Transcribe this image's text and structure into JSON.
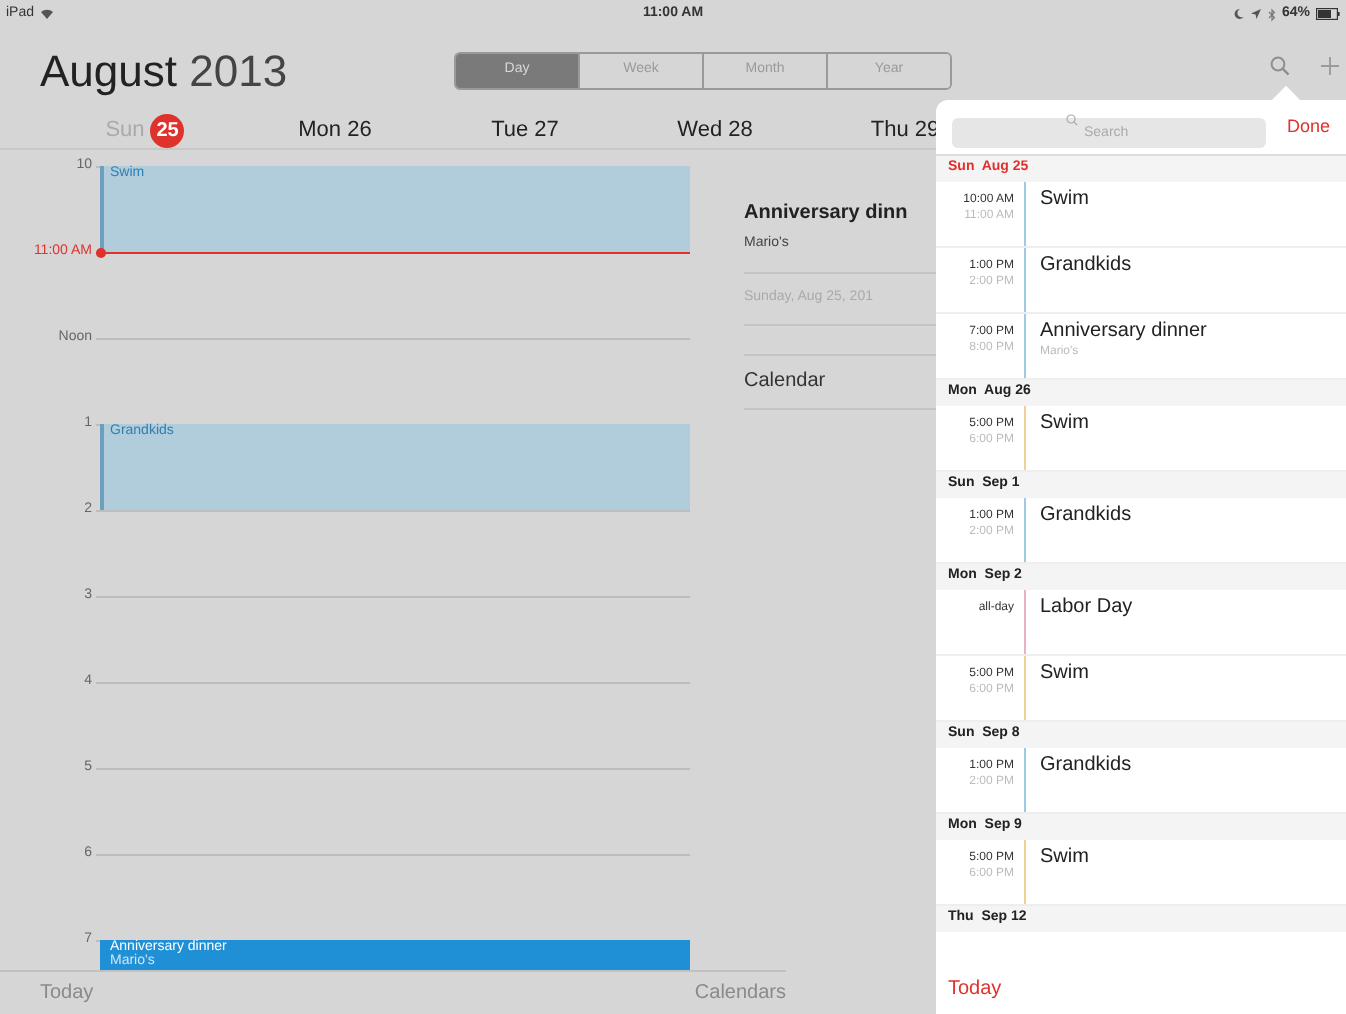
{
  "status_bar": {
    "device": "iPad",
    "time": "11:00 AM",
    "battery": "64%"
  },
  "header": {
    "month": "August",
    "year": "2013",
    "view_tabs": [
      {
        "label": "Day",
        "selected": true
      },
      {
        "label": "Week",
        "selected": false
      },
      {
        "label": "Month",
        "selected": false
      },
      {
        "label": "Year",
        "selected": false
      }
    ]
  },
  "day_strip": [
    {
      "weekday": "Sun",
      "day": "25",
      "today": true
    },
    {
      "weekday": "Mon",
      "day": "26",
      "today": false
    },
    {
      "weekday": "Tue",
      "day": "27",
      "today": false
    },
    {
      "weekday": "Wed",
      "day": "28",
      "today": false
    },
    {
      "weekday": "Thu",
      "day": "29",
      "today": false
    }
  ],
  "timeline": [
    {
      "label": "10",
      "kind": "hour",
      "event": {
        "title": "Swim",
        "selected": false
      }
    },
    {
      "label": "11:00 AM",
      "kind": "now"
    },
    {
      "label": "Noon",
      "kind": "hour"
    },
    {
      "label": "1",
      "kind": "hour",
      "event": {
        "title": "Grandkids",
        "selected": false
      }
    },
    {
      "label": "2",
      "kind": "hour"
    },
    {
      "label": "3",
      "kind": "hour"
    },
    {
      "label": "4",
      "kind": "hour"
    },
    {
      "label": "5",
      "kind": "hour"
    },
    {
      "label": "6",
      "kind": "hour"
    },
    {
      "label": "7",
      "kind": "hour",
      "event": {
        "title": "Anniversary dinner",
        "location": "Mario's",
        "selected": true
      }
    }
  ],
  "event_detail": {
    "title": "Anniversary dinn",
    "location": "Mario's",
    "date": "Sunday, Aug 25, 201",
    "calendar": "Calendar"
  },
  "search_popover": {
    "placeholder": "Search",
    "done": "Done",
    "sections": [
      {
        "date": "Sun  Aug 25",
        "today": true,
        "events": [
          {
            "start": "10:00 AM",
            "end": "11:00 AM",
            "title": "Swim",
            "color": "#9ccbe2"
          },
          {
            "start": "1:00 PM",
            "end": "2:00 PM",
            "title": "Grandkids",
            "color": "#9ccbe2"
          },
          {
            "start": "7:00 PM",
            "end": "8:00 PM",
            "title": "Anniversary dinner",
            "location": "Mario's",
            "color": "#9ccbe2"
          }
        ]
      },
      {
        "date": "Mon  Aug 26",
        "today": false,
        "events": [
          {
            "start": "5:00 PM",
            "end": "6:00 PM",
            "title": "Swim",
            "color": "#f2cf99"
          }
        ]
      },
      {
        "date": "Sun  Sep 1",
        "today": false,
        "events": [
          {
            "start": "1:00 PM",
            "end": "2:00 PM",
            "title": "Grandkids",
            "color": "#9ccbe2"
          }
        ]
      },
      {
        "date": "Mon  Sep 2",
        "today": false,
        "events": [
          {
            "start": "all-day",
            "title": "Labor Day",
            "color": "#eab0c4"
          },
          {
            "start": "5:00 PM",
            "end": "6:00 PM",
            "title": "Swim",
            "color": "#f2cf99"
          }
        ]
      },
      {
        "date": "Sun  Sep 8",
        "today": false,
        "events": [
          {
            "start": "1:00 PM",
            "end": "2:00 PM",
            "title": "Grandkids",
            "color": "#9ccbe2"
          }
        ]
      },
      {
        "date": "Mon  Sep 9",
        "today": false,
        "events": [
          {
            "start": "5:00 PM",
            "end": "6:00 PM",
            "title": "Swim",
            "color": "#f2cf99"
          }
        ]
      },
      {
        "date": "Thu  Sep 12",
        "today": false
      }
    ],
    "today_button": "Today"
  },
  "bottom_bar": {
    "today": "Today",
    "calendars": "Calendars"
  }
}
